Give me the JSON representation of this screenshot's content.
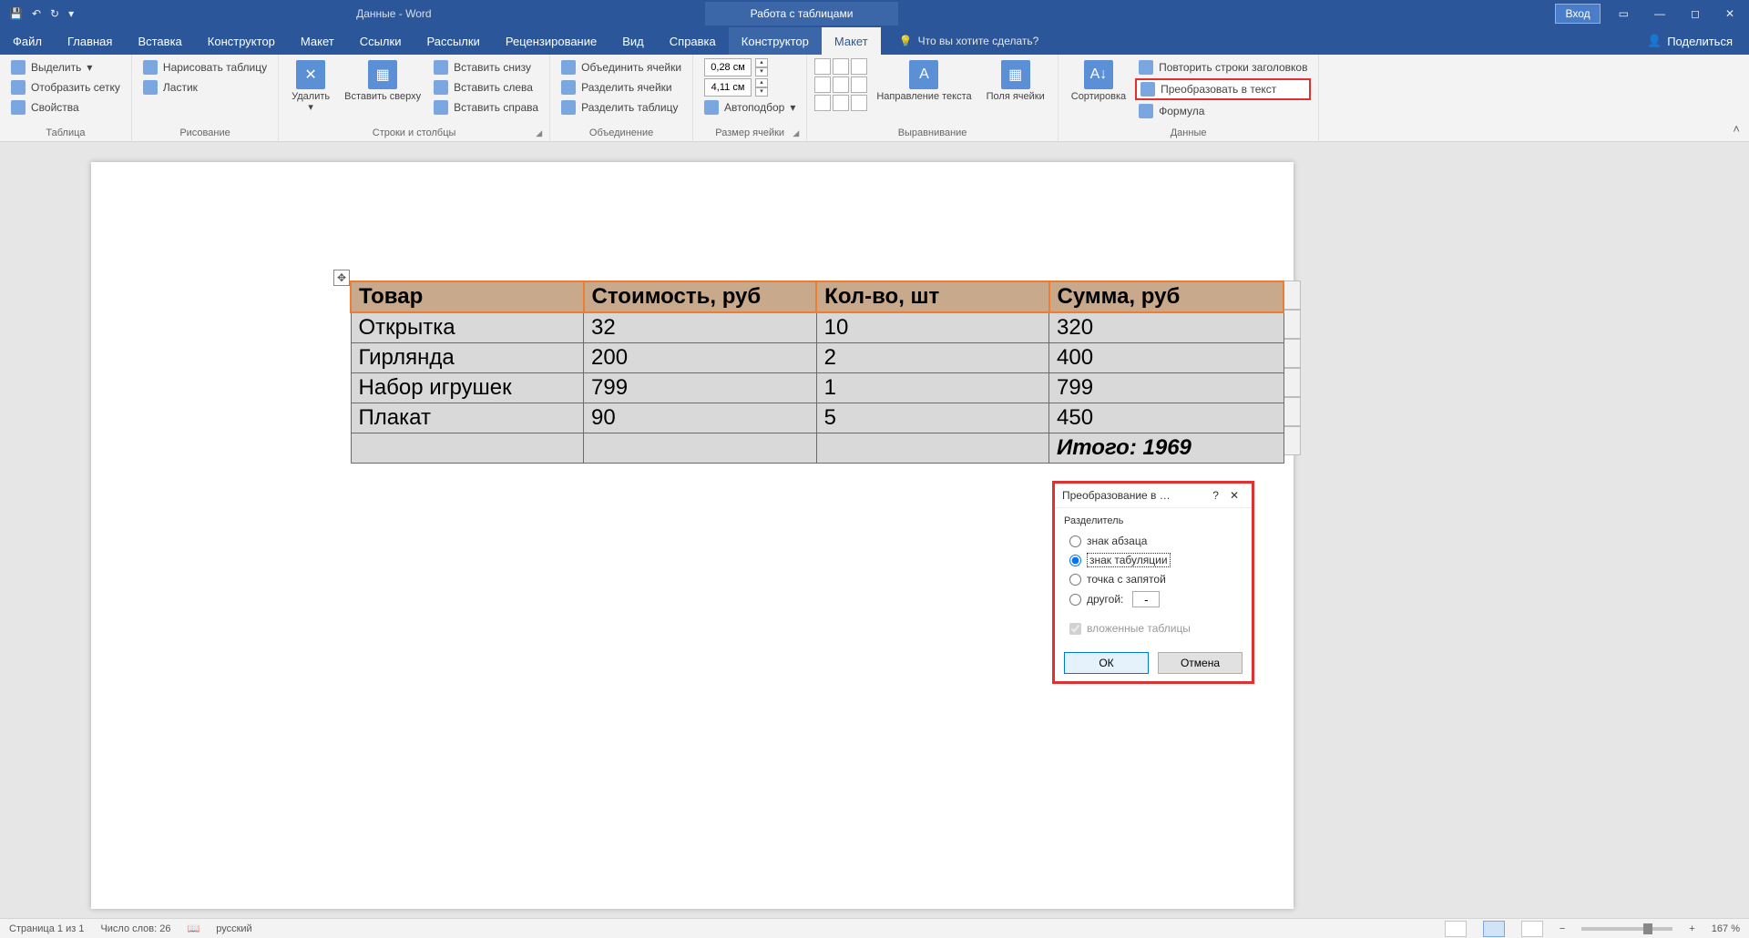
{
  "titlebar": {
    "doc": "Данные  -  Word",
    "context": "Работа с таблицами",
    "login": "Вход"
  },
  "tabs": {
    "file": "Файл",
    "home": "Главная",
    "insert": "Вставка",
    "design": "Конструктор",
    "layout": "Макет",
    "refs": "Ссылки",
    "mail": "Рассылки",
    "review": "Рецензирование",
    "view": "Вид",
    "help": "Справка",
    "tbl_design": "Конструктор",
    "tbl_layout": "Макет",
    "tell": "Что вы хотите сделать?",
    "share": "Поделиться"
  },
  "ribbon": {
    "table": {
      "select": "Выделить",
      "gridlines": "Отобразить сетку",
      "properties": "Свойства",
      "label": "Таблица"
    },
    "draw": {
      "draw": "Нарисовать таблицу",
      "eraser": "Ластик",
      "label": "Рисование"
    },
    "rowscols": {
      "delete": "Удалить",
      "insert_above": "Вставить сверху",
      "insert_below": "Вставить снизу",
      "insert_left": "Вставить слева",
      "insert_right": "Вставить справа",
      "label": "Строки и столбцы"
    },
    "merge": {
      "merge": "Объединить ячейки",
      "split": "Разделить ячейки",
      "split_table": "Разделить таблицу",
      "label": "Объединение"
    },
    "size": {
      "h": "0,28 см",
      "w": "4,11 см",
      "autofit": "Автоподбор",
      "label": "Размер ячейки"
    },
    "align": {
      "textdir": "Направление текста",
      "margins": "Поля ячейки",
      "label": "Выравнивание"
    },
    "sort": {
      "sort": "Сортировка"
    },
    "data": {
      "repeat": "Повторить строки заголовков",
      "convert": "Преобразовать в текст",
      "formula": "Формула",
      "label": "Данные"
    }
  },
  "table": {
    "headers": [
      "Товар",
      "Стоимость, руб",
      "Кол-во, шт",
      "Сумма, руб"
    ],
    "rows": [
      [
        "Открытка",
        "32",
        "10",
        "320"
      ],
      [
        "Гирлянда",
        "200",
        "2",
        "400"
      ],
      [
        "Набор игрушек",
        "799",
        "1",
        "799"
      ],
      [
        "Плакат",
        "90",
        "5",
        "450"
      ]
    ],
    "total": "Итого: 1969"
  },
  "dialog": {
    "title": "Преобразование в …",
    "sep_label": "Разделитель",
    "opts": {
      "para": "знак абзаца",
      "tab": "знак табуляции",
      "semi": "точка с запятой",
      "other": "другой:",
      "other_val": "-"
    },
    "nested": "вложенные таблицы",
    "ok": "ОК",
    "cancel": "Отмена"
  },
  "status": {
    "page": "Страница 1 из 1",
    "words": "Число слов: 26",
    "lang": "русский",
    "zoom": "167 %"
  }
}
